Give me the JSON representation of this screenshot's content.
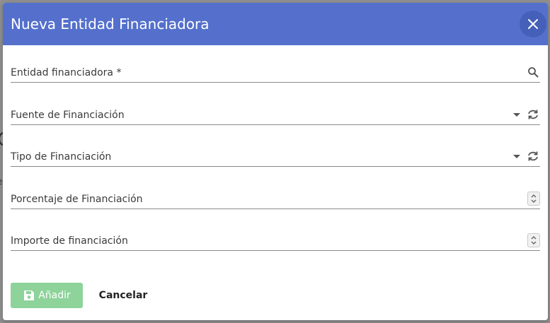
{
  "dialog": {
    "title": "Nueva Entidad Financiadora",
    "header_color": "#5470cc",
    "close_icon": "close-icon"
  },
  "fields": {
    "entidad": {
      "label": "Entidad financiadora *",
      "value": "",
      "icon": "search-icon"
    },
    "fuente": {
      "label": "Fuente de Financiación",
      "value": "",
      "icons": [
        "chevron-down-icon",
        "refresh-icon"
      ]
    },
    "tipo": {
      "label": "Tipo de Financiación",
      "value": "",
      "icons": [
        "chevron-down-icon",
        "refresh-icon"
      ]
    },
    "porcentaje": {
      "label": "Porcentaje de Financiación",
      "value": "",
      "icon": "stepper-icon"
    },
    "importe": {
      "label": "Importe de financiación",
      "value": "",
      "icon": "stepper-icon"
    }
  },
  "actions": {
    "add_label": "Añadir",
    "add_icon": "save-icon",
    "add_color": "#8dd39a",
    "cancel_label": "Cancelar"
  }
}
